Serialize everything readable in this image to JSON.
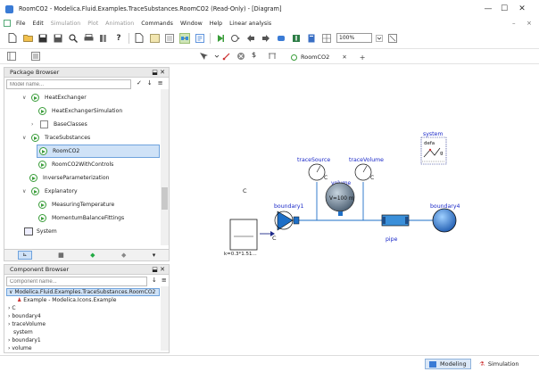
{
  "window": {
    "title": "RoomCO2 - Modelica.Fluid.Examples.TraceSubstances.RoomCO2  (Read-Only) - [Diagram]",
    "minimize": "—",
    "maximize": "☐",
    "close": "✕"
  },
  "menubar": {
    "items": [
      "File",
      "Edit",
      "Simulation",
      "Plot",
      "Animation",
      "Commands",
      "Window",
      "Help",
      "Linear analysis"
    ]
  },
  "toolbar": {
    "zoom": "100%"
  },
  "doc_tab": {
    "label": "RoomCO2",
    "close": "✕",
    "pin": "+"
  },
  "package_browser": {
    "title": "Package Browser",
    "filter_placeholder": "Model name...",
    "items": [
      {
        "label": "HeatExchanger",
        "kind": "package",
        "expanded": true
      },
      {
        "label": "HeatExchangerSimulation",
        "kind": "model"
      },
      {
        "label": "BaseClasses",
        "kind": "package-collapsed"
      },
      {
        "label": "TraceSubstances",
        "kind": "package",
        "expanded": true
      },
      {
        "label": "RoomCO2",
        "kind": "model",
        "selected": true
      },
      {
        "label": "RoomCO2WithControls",
        "kind": "model"
      },
      {
        "label": "InverseParameterization",
        "kind": "model"
      },
      {
        "label": "Explanatory",
        "kind": "package",
        "expanded": true
      },
      {
        "label": "MeasuringTemperature",
        "kind": "model"
      },
      {
        "label": "MomentumBalanceFittings",
        "kind": "model"
      },
      {
        "label": "System",
        "kind": "block"
      }
    ]
  },
  "component_browser": {
    "title": "Component Browser",
    "filter_placeholder": "Component name...",
    "root": "Modelica.Fluid.Examples.TraceSubstances.RoomCO2",
    "items": [
      "Example - Modelica.Icons.Example",
      "C",
      "boundary4",
      "traceVolume",
      "system",
      "boundary1",
      "volume"
    ]
  },
  "diagram": {
    "labels": {
      "C": "C",
      "C_expr": "k=0.3*1.51...",
      "boundary1": "boundary1",
      "boundary1_C": "C",
      "traceSource": "traceSource",
      "traceSource_C": "C",
      "volume": "volume",
      "volume_value": "V=100 m",
      "traceVolume": "traceVolume",
      "traceVolume_C": "C",
      "pipe": "pipe",
      "boundary4": "boundary4",
      "system": "system",
      "system_text": "defa",
      "system_g": "g"
    }
  },
  "statusbar": {
    "modeling": "Modeling",
    "simulation": "Simulation"
  },
  "colors": {
    "accent": "#2a2aff",
    "selection": "#cfe2f7",
    "pipe_fill": "#3a8fd9",
    "connector": "#1e6fc7"
  }
}
